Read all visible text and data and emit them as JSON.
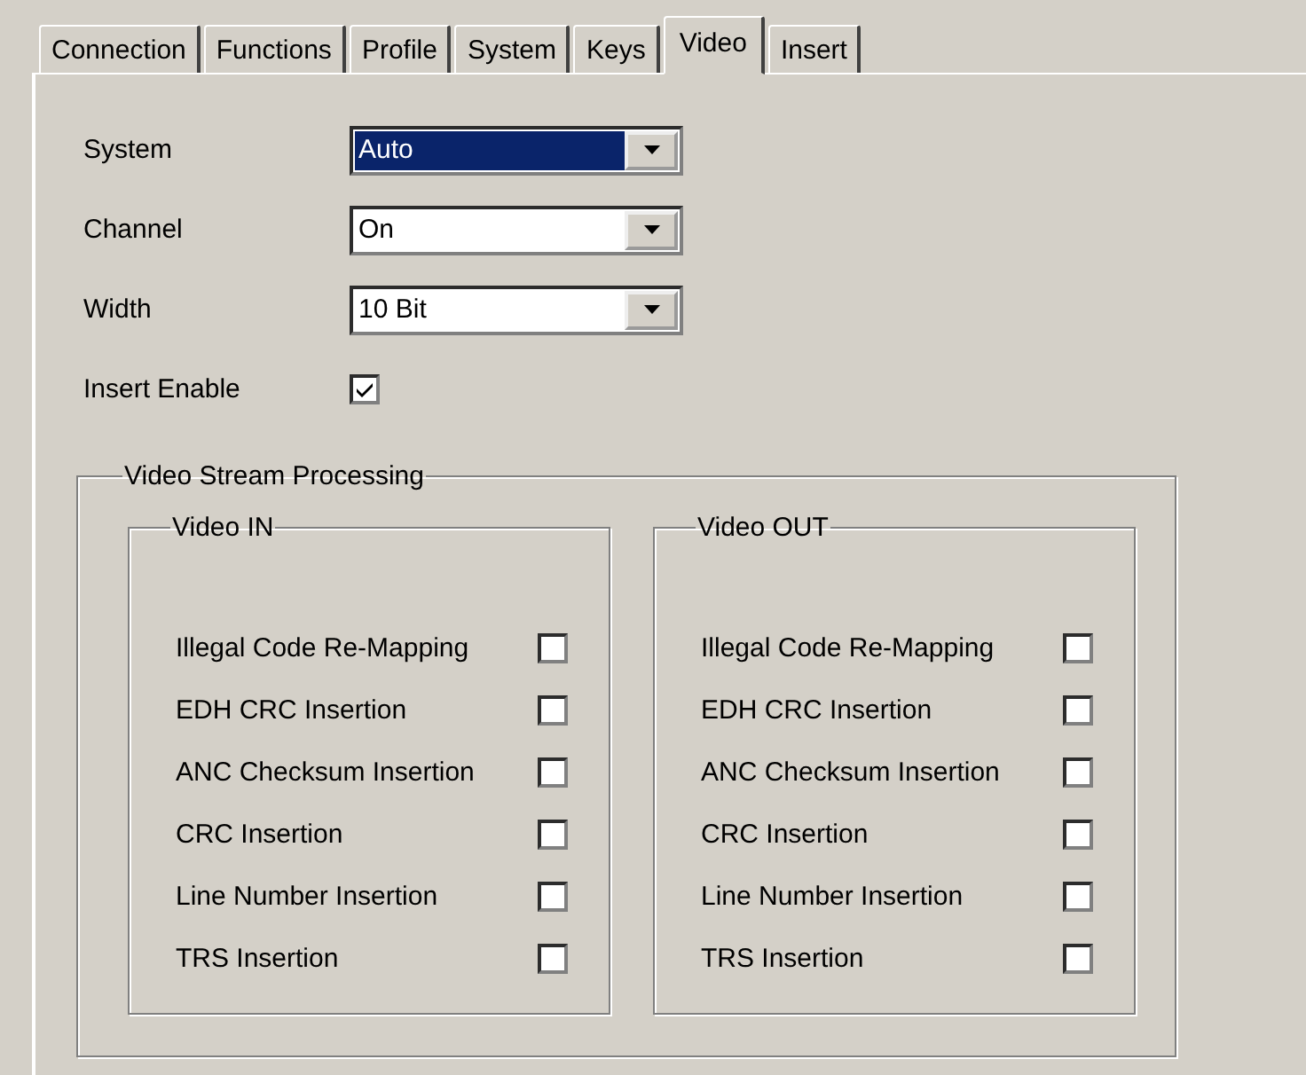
{
  "tabs": [
    {
      "label": "Connection",
      "selected": false
    },
    {
      "label": "Functions",
      "selected": false
    },
    {
      "label": "Profile",
      "selected": false
    },
    {
      "label": "System",
      "selected": false
    },
    {
      "label": "Keys",
      "selected": false
    },
    {
      "label": "Video",
      "selected": true
    },
    {
      "label": "Insert",
      "selected": false
    }
  ],
  "fields": [
    {
      "kind": "dropdown",
      "label": "System",
      "value": "Auto",
      "focused": true
    },
    {
      "kind": "dropdown",
      "label": "Channel",
      "value": "On",
      "focused": false
    },
    {
      "kind": "dropdown",
      "label": "Width",
      "value": "10 Bit",
      "focused": false
    },
    {
      "kind": "checkbox",
      "label": "Insert Enable",
      "checked": true
    }
  ],
  "stream_group": {
    "title": "Video Stream Processing",
    "groups": [
      {
        "title": "Video IN",
        "options": [
          {
            "label": "Illegal Code Re-Mapping",
            "checked": false
          },
          {
            "label": "EDH CRC Insertion",
            "checked": false
          },
          {
            "label": "ANC Checksum Insertion",
            "checked": false
          },
          {
            "label": "CRC Insertion",
            "checked": false
          },
          {
            "label": "Line Number Insertion",
            "checked": false
          },
          {
            "label": "TRS Insertion",
            "checked": false
          }
        ]
      },
      {
        "title": "Video OUT",
        "options": [
          {
            "label": "Illegal Code Re-Mapping",
            "checked": false
          },
          {
            "label": "EDH CRC Insertion",
            "checked": false
          },
          {
            "label": "ANC Checksum Insertion",
            "checked": false
          },
          {
            "label": "CRC Insertion",
            "checked": false
          },
          {
            "label": "Line Number Insertion",
            "checked": false
          },
          {
            "label": "TRS Insertion",
            "checked": false
          }
        ]
      }
    ]
  }
}
